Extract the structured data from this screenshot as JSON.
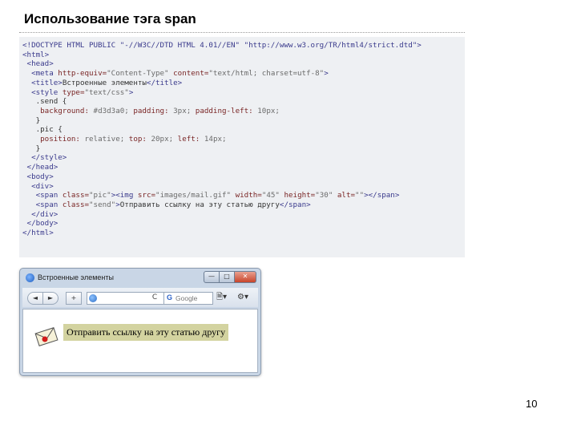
{
  "slide": {
    "title": "Использование тэга span",
    "page_number": "10"
  },
  "code": {
    "lines": [
      [
        {
          "c": "t",
          "s": "<!DOCTYPE HTML PUBLIC \"-//W3C//DTD HTML 4.01//EN\" \"http://www.w3.org/TR/html4/strict.dtd\">"
        }
      ],
      [
        {
          "c": "t",
          "s": "<html>"
        }
      ],
      [
        {
          "c": "x",
          "s": " "
        },
        {
          "c": "t",
          "s": "<head>"
        }
      ],
      [
        {
          "c": "x",
          "s": "  "
        },
        {
          "c": "t",
          "s": "<meta "
        },
        {
          "c": "a",
          "s": "http-equiv="
        },
        {
          "c": "v",
          "s": "\"Content-Type\" "
        },
        {
          "c": "a",
          "s": "content="
        },
        {
          "c": "v",
          "s": "\"text/html; charset=utf-8\""
        },
        {
          "c": "t",
          "s": ">"
        }
      ],
      [
        {
          "c": "x",
          "s": "  "
        },
        {
          "c": "t",
          "s": "<title>"
        },
        {
          "c": "x",
          "s": "Встроенные элементы"
        },
        {
          "c": "t",
          "s": "</title>"
        }
      ],
      [
        {
          "c": "x",
          "s": "  "
        },
        {
          "c": "t",
          "s": "<style "
        },
        {
          "c": "a",
          "s": "type="
        },
        {
          "c": "v",
          "s": "\"text/css\""
        },
        {
          "c": "t",
          "s": ">"
        }
      ],
      [
        {
          "c": "x",
          "s": "   .send {"
        }
      ],
      [
        {
          "c": "x",
          "s": "    "
        },
        {
          "c": "a",
          "s": "background: "
        },
        {
          "c": "v",
          "s": "#d3d3a0; "
        },
        {
          "c": "a",
          "s": "padding: "
        },
        {
          "c": "v",
          "s": "3px; "
        },
        {
          "c": "a",
          "s": "padding-left: "
        },
        {
          "c": "v",
          "s": "10px;"
        }
      ],
      [
        {
          "c": "x",
          "s": "   }"
        }
      ],
      [
        {
          "c": "x",
          "s": "   .pic {"
        }
      ],
      [
        {
          "c": "x",
          "s": "    "
        },
        {
          "c": "a",
          "s": "position: "
        },
        {
          "c": "v",
          "s": "relative; "
        },
        {
          "c": "a",
          "s": "top: "
        },
        {
          "c": "v",
          "s": "20px; "
        },
        {
          "c": "a",
          "s": "left: "
        },
        {
          "c": "v",
          "s": "14px;"
        }
      ],
      [
        {
          "c": "x",
          "s": "   }"
        }
      ],
      [
        {
          "c": "x",
          "s": "  "
        },
        {
          "c": "t",
          "s": "</style>"
        }
      ],
      [
        {
          "c": "x",
          "s": " "
        },
        {
          "c": "t",
          "s": "</head>"
        }
      ],
      [
        {
          "c": "x",
          "s": " "
        },
        {
          "c": "t",
          "s": "<body>"
        }
      ],
      [
        {
          "c": "x",
          "s": "  "
        },
        {
          "c": "t",
          "s": "<div>"
        }
      ],
      [
        {
          "c": "x",
          "s": "   "
        },
        {
          "c": "t",
          "s": "<span "
        },
        {
          "c": "a",
          "s": "class="
        },
        {
          "c": "v",
          "s": "\"pic\""
        },
        {
          "c": "t",
          "s": "><img "
        },
        {
          "c": "a",
          "s": "src="
        },
        {
          "c": "v",
          "s": "\"images/mail.gif\" "
        },
        {
          "c": "a",
          "s": "width="
        },
        {
          "c": "v",
          "s": "\"45\" "
        },
        {
          "c": "a",
          "s": "height="
        },
        {
          "c": "v",
          "s": "\"30\" "
        },
        {
          "c": "a",
          "s": "alt="
        },
        {
          "c": "v",
          "s": "\"\""
        },
        {
          "c": "t",
          "s": "></span>"
        }
      ],
      [
        {
          "c": "x",
          "s": "   "
        },
        {
          "c": "t",
          "s": "<span "
        },
        {
          "c": "a",
          "s": "class="
        },
        {
          "c": "v",
          "s": "\"send\""
        },
        {
          "c": "t",
          "s": ">"
        },
        {
          "c": "x",
          "s": "Отправить ссылку на эту статью другу"
        },
        {
          "c": "t",
          "s": "</span>"
        }
      ],
      [
        {
          "c": "x",
          "s": "  "
        },
        {
          "c": "t",
          "s": "</div>"
        }
      ],
      [
        {
          "c": "x",
          "s": " "
        },
        {
          "c": "t",
          "s": "</body>"
        }
      ],
      [
        {
          "c": "t",
          "s": "</html>"
        }
      ]
    ]
  },
  "browser": {
    "window_title": "Встроенные элементы",
    "minimize_label": "—",
    "maximize_label": "□",
    "close_label": "✕",
    "back_label": "◄",
    "forward_label": "►",
    "add_label": "+",
    "reload_label": "C",
    "search_placeholder": "Google",
    "search_engine_glyph": "G",
    "page_menu_glyph": "🗎▾",
    "tools_menu_glyph": "⚙▾",
    "span_text": "Отправить ссылку на эту статью другу",
    "span_background": "#d3d3a0"
  }
}
